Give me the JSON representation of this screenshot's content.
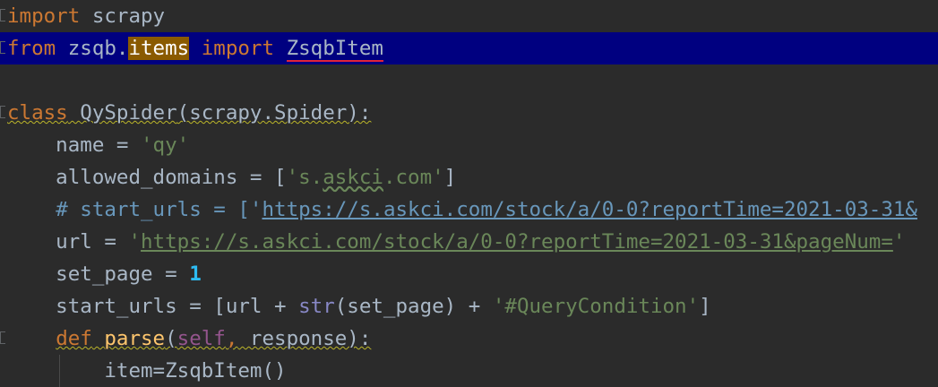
{
  "code": {
    "l1": {
      "kw_import": "import",
      "module": " scrapy"
    },
    "l2": {
      "kw_from": "from",
      "mod_prefix": " zsqb.",
      "mod_items": "items",
      "sp1": " ",
      "kw_import": "import",
      "sp2": " ",
      "cls": "ZsqbItem"
    },
    "l4": {
      "kw_class": "class",
      "sp": " ",
      "cls": "QySpider",
      "rest": "(scrapy.Spider):"
    },
    "l5": {
      "name": "    name = ",
      "val": "'qy'"
    },
    "l6": {
      "lhs": "    allowed_domains = [",
      "q1": "'s.",
      "askci": "askci",
      "q2": ".com'",
      "close": "]"
    },
    "l7": {
      "indent": "    ",
      "c1": "# start_urls = ['",
      "link": "https://s.askci.com/stock/a/0-0?reportTime=2021-03-31&"
    },
    "l8": {
      "lhs": "    url = ",
      "q": "'",
      "link": "https://s.askci.com/stock/a/0-0?reportTime=2021-03-31&pageNum=",
      "q2": "'"
    },
    "l9": {
      "lhs": "    set_page = ",
      "num": "1"
    },
    "l10": {
      "lhs": "    start_urls = [url + ",
      "builtin": "str",
      "mid": "(set_page) + ",
      "str": "'#QueryCondition'",
      "close": "]"
    },
    "l11": {
      "indent": "    ",
      "kw_def": "def",
      "sp": " ",
      "fn": "parse",
      "open": "(",
      "self": "self",
      "comma": ",",
      "args": " response):"
    },
    "l12": {
      "text": "        item=ZsqbItem()"
    }
  }
}
